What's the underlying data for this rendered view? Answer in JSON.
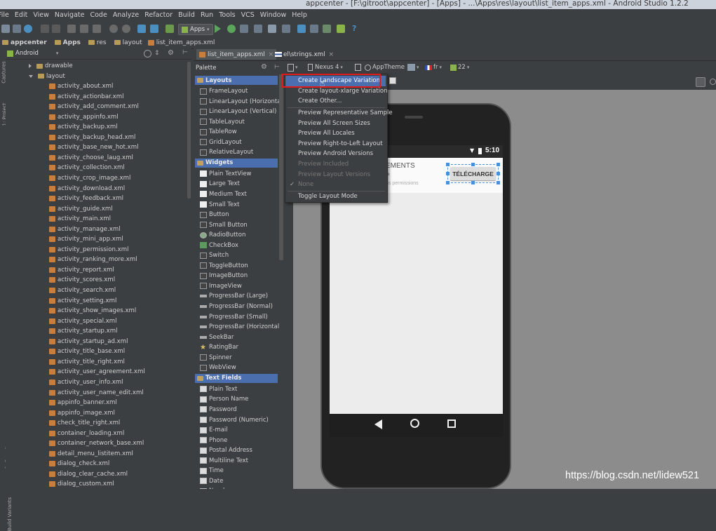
{
  "window": {
    "title": "appcenter - [F:\\gitroot\\appcenter] - [Apps] - ...\\Apps\\res\\layout\\list_item_apps.xml - Android Studio 1.2.2"
  },
  "menubar": [
    "File",
    "Edit",
    "View",
    "Navigate",
    "Code",
    "Analyze",
    "Refactor",
    "Build",
    "Run",
    "Tools",
    "VCS",
    "Window",
    "Help"
  ],
  "toolbar": {
    "run_config": "Apps"
  },
  "breadcrumb": [
    "appcenter",
    "Apps",
    "res",
    "layout",
    "list_item_apps.xml"
  ],
  "side_tabs": [
    "Captures",
    "1: Project",
    "2: Structure",
    "2: Favorites",
    "Build Variants"
  ],
  "project": {
    "view_mode": "Android",
    "folders": [
      "drawable",
      "layout"
    ],
    "files": [
      "activity_about.xml",
      "activity_actionbar.xml",
      "activity_add_comment.xml",
      "activity_appinfo.xml",
      "activity_backup.xml",
      "activity_backup_head.xml",
      "activity_base_new_hot.xml",
      "activity_choose_laug.xml",
      "activity_collection.xml",
      "activity_crop_image.xml",
      "activity_download.xml",
      "activity_feedback.xml",
      "activity_guide.xml",
      "activity_main.xml",
      "activity_manage.xml",
      "activity_mini_app.xml",
      "activity_permission.xml",
      "activity_ranking_more.xml",
      "activity_report.xml",
      "activity_scores.xml",
      "activity_search.xml",
      "activity_setting.xml",
      "activity_show_images.xml",
      "activity_special.xml",
      "activity_startup.xml",
      "activity_startup_ad.xml",
      "activity_title_base.xml",
      "activity_title_right.xml",
      "activity_user_agreement.xml",
      "activity_user_info.xml",
      "activity_user_name_edit.xml",
      "appinfo_banner.xml",
      "appinfo_image.xml",
      "check_title_right.xml",
      "container_loading.xml",
      "container_network_base.xml",
      "detail_menu_listitem.xml",
      "dialog_check.xml",
      "dialog_clear_cache.xml",
      "dialog_custom.xml"
    ]
  },
  "editor_tabs": [
    "list_item_apps.xml",
    "el\\strings.xml"
  ],
  "palette": {
    "title": "Palette",
    "sections": [
      {
        "name": "Layouts",
        "items": [
          "FrameLayout",
          "LinearLayout (Horizontal)",
          "LinearLayout (Vertical)",
          "TableLayout",
          "TableRow",
          "GridLayout",
          "RelativeLayout"
        ]
      },
      {
        "name": "Widgets",
        "items": [
          "Plain TextView",
          "Large Text",
          "Medium Text",
          "Small Text",
          "Button",
          "Small Button",
          "RadioButton",
          "CheckBox",
          "Switch",
          "ToggleButton",
          "ImageButton",
          "ImageView",
          "ProgressBar (Large)",
          "ProgressBar (Normal)",
          "ProgressBar (Small)",
          "ProgressBar (Horizontal)",
          "SeekBar",
          "RatingBar",
          "Spinner",
          "WebView"
        ]
      },
      {
        "name": "Text Fields",
        "items": [
          "Plain Text",
          "Person Name",
          "Password",
          "Password (Numeric)",
          "E-mail",
          "Phone",
          "Postal Address",
          "Multiline Text",
          "Time",
          "Date",
          "Number"
        ]
      }
    ]
  },
  "design_toolbar": {
    "device": "Nexus 4",
    "theme": "AppTheme",
    "locale": "fr",
    "api": "22"
  },
  "dropdown_menu": {
    "items": [
      {
        "label": "Create Landscape Variation",
        "state": "selected"
      },
      {
        "label": "Create layout-xlarge Variation",
        "state": "normal"
      },
      {
        "label": "Create Other...",
        "state": "normal"
      },
      {
        "label": "Preview Representative Sample",
        "state": "normal"
      },
      {
        "label": "Preview All Screen Sizes",
        "state": "normal"
      },
      {
        "label": "Preview All Locales",
        "state": "normal"
      },
      {
        "label": "Preview Right-to-Left Layout",
        "state": "normal"
      },
      {
        "label": "Preview Android Versions",
        "state": "normal"
      },
      {
        "label": "Preview Included",
        "state": "disabled"
      },
      {
        "label": "Preview Layout Versions",
        "state": "disabled"
      },
      {
        "label": "None",
        "state": "disabled-checked"
      },
      {
        "label": "Toggle Layout Mode",
        "state": "normal"
      }
    ]
  },
  "device_preview": {
    "status_time": "5:10",
    "item_title": "EMENTS",
    "item_sub": "ns permissions",
    "button_label": "TÉLÉCHARGE"
  },
  "watermark": "https://blog.csdn.net/lidew521",
  "colors": {
    "selection": "#4b6eaf",
    "highlight_border": "#e01b1b",
    "ide_bg": "#3c3f41"
  }
}
